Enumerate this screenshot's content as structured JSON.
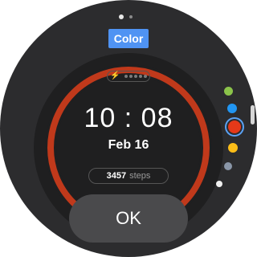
{
  "header": {
    "title": "Color"
  },
  "pager": {
    "pages": 2,
    "active_index": 0
  },
  "watch_face": {
    "time": "10 : 08",
    "date": "Feb 16",
    "steps_count": "3457",
    "steps_unit": "steps",
    "battery_icon": "lightning-bolt-icon",
    "ring_color": "#c0391b"
  },
  "color_options": [
    {
      "name": "green",
      "color": "#8bc34a",
      "selected": false
    },
    {
      "name": "blue",
      "color": "#2196f3",
      "selected": false
    },
    {
      "name": "red",
      "color": "#e53919",
      "selected": true
    },
    {
      "name": "amber",
      "color": "#fbbd18",
      "selected": false
    },
    {
      "name": "gray",
      "color": "#8a96a8",
      "selected": false
    },
    {
      "name": "white",
      "color": "#f0f0f0",
      "selected": false
    }
  ],
  "ok_button": {
    "label": "OK"
  }
}
